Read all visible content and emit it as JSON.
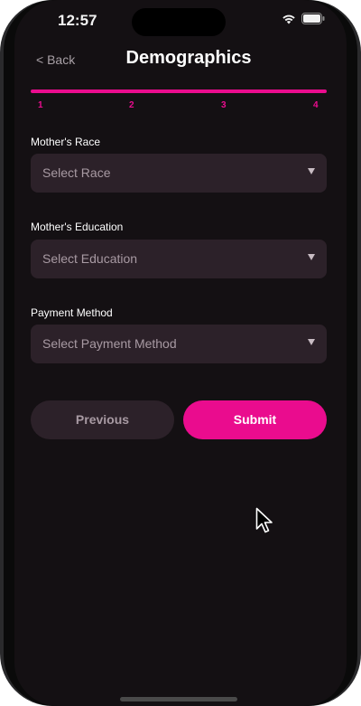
{
  "status_bar": {
    "time": "12:57"
  },
  "header": {
    "back_label": "< Back",
    "title": "Demographics"
  },
  "progress": {
    "steps": [
      "1",
      "2",
      "3",
      "4"
    ],
    "fraction": 1.0
  },
  "form": {
    "fields": [
      {
        "label": "Mother's Race",
        "placeholder": "Select Race"
      },
      {
        "label": "Mother's Education",
        "placeholder": "Select Education"
      },
      {
        "label": "Payment Method",
        "placeholder": "Select Payment Method"
      }
    ]
  },
  "actions": {
    "previous_label": "Previous",
    "submit_label": "Submit"
  },
  "colors": {
    "accent": "#ea0c8e",
    "background": "#141013",
    "input_bg": "#2c2129"
  },
  "icons": [
    "wifi-icon",
    "battery-icon",
    "chevron-down-icon",
    "cursor-icon"
  ]
}
